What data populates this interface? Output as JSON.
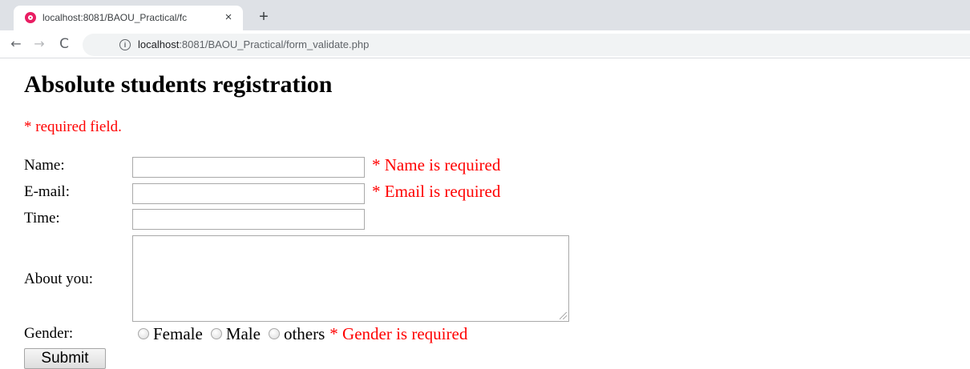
{
  "browser": {
    "tab": {
      "title": "localhost:8081/BAOU_Practical/fc",
      "close_glyph": "×"
    },
    "new_tab_glyph": "+",
    "nav": {
      "back_glyph": "←",
      "forward_glyph": "→",
      "reload_glyph": "C"
    },
    "address_bar": {
      "info_glyph": "i",
      "host": "localhost",
      "rest": ":8081/BAOU_Practical/form_validate.php"
    }
  },
  "page": {
    "title": "Absolute students registration",
    "required_note": "* required field.",
    "form": {
      "name": {
        "label": "Name:",
        "value": "",
        "error": "* Name is required"
      },
      "email": {
        "label": "E-mail:",
        "value": "",
        "error": "* Email is required"
      },
      "time": {
        "label": "Time:",
        "value": ""
      },
      "about": {
        "label": "About you:",
        "value": ""
      },
      "gender": {
        "label": "Gender:",
        "options": [
          "Female",
          "Male",
          "others"
        ],
        "error": "* Gender is required"
      },
      "submit_label": "Submit"
    }
  },
  "colors": {
    "error_red": "#ff0000",
    "tabstrip": "#dee1e6",
    "omnibox": "#f1f3f4"
  }
}
